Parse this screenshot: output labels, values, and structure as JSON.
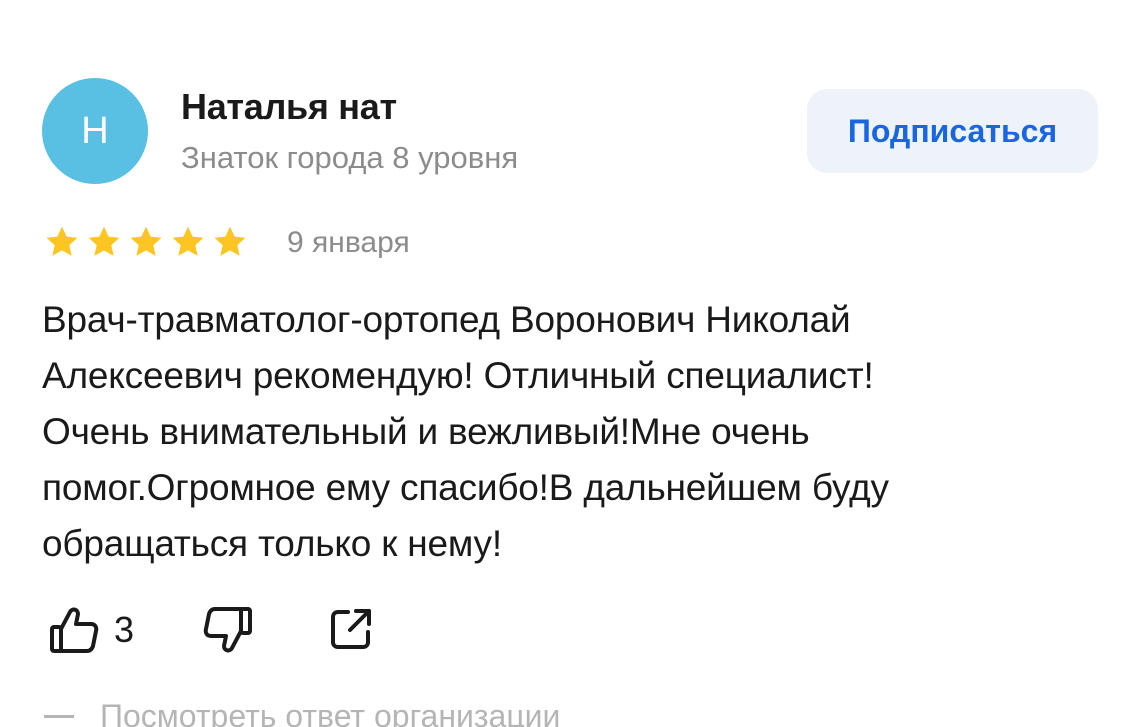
{
  "author": {
    "avatar_letter": "Н",
    "avatar_color": "#5ac0e3",
    "name": "Наталья нат",
    "status": "Знаток города 8 уровня"
  },
  "subscribe_label": "Подписаться",
  "review": {
    "rating": 5,
    "rating_max": 5,
    "date": "9 января",
    "lines": [
      "Врач-травматолог-ортопед Воронович Николай",
      "Алексеевич рекомендую! Отличный специалист!",
      "Очень внимательный и вежливый!Мне очень",
      "помог.Огромное ему спасибо!В дальнейшем буду",
      "обращаться только к нему!"
    ]
  },
  "actions": {
    "like_icon": "thumbs-up-icon",
    "like_count": "3",
    "dislike_icon": "thumbs-down-icon",
    "share_icon": "share-icon"
  },
  "org_reply_label": "Посмотреть ответ организации",
  "colors": {
    "accent": "#1a66e0",
    "star": "#fcc521",
    "muted": "#8c8c8c"
  }
}
